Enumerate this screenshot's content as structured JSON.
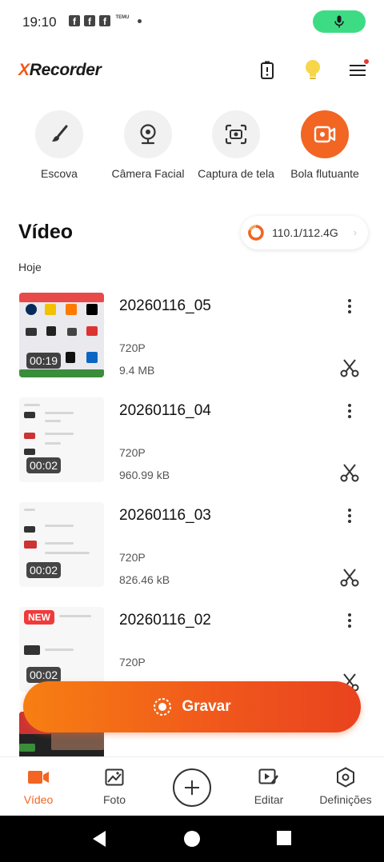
{
  "status_bar": {
    "time": "19:10",
    "notif_temu": "TEMU"
  },
  "header": {
    "logo_prefix": "X",
    "logo_rest": "Recorder"
  },
  "tools": [
    {
      "label": "Escova",
      "icon": "brush-icon"
    },
    {
      "label": "Câmera Facial",
      "icon": "webcam-icon"
    },
    {
      "label": "Captura de tela",
      "icon": "screenshot-icon"
    },
    {
      "label": "Bola flutuante",
      "icon": "floating-ball-icon",
      "active": true
    }
  ],
  "section": {
    "title": "Vídeo",
    "storage": "110.1/112.4G",
    "date_group": "Hoje"
  },
  "videos": [
    {
      "name": "20260116_05",
      "resolution": "720P",
      "size": "9.4 MB",
      "duration": "00:19"
    },
    {
      "name": "20260116_04",
      "resolution": "720P",
      "size": "960.99 kB",
      "duration": "00:02"
    },
    {
      "name": "20260116_03",
      "resolution": "720P",
      "size": "826.46 kB",
      "duration": "00:02"
    },
    {
      "name": "20260116_02",
      "resolution": "720P",
      "duration": "00:02",
      "badge": "NEW"
    }
  ],
  "record_button": {
    "label": "Gravar"
  },
  "bottom_nav": [
    {
      "label": "Vídeo",
      "active": true
    },
    {
      "label": "Foto"
    },
    {
      "label": "Editar"
    },
    {
      "label": "Definições"
    }
  ],
  "colors": {
    "accent": "#f26522",
    "mic_green": "#3ddc84"
  }
}
